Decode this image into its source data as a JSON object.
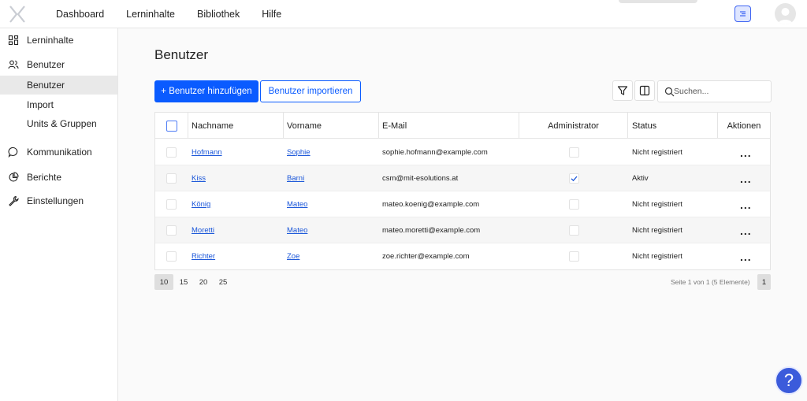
{
  "topnav": {
    "items": [
      "Dashboard",
      "Lerninhalte",
      "Bibliothek",
      "Hilfe"
    ]
  },
  "sidebar": {
    "items": [
      {
        "label": "Lerninhalte",
        "icon": "grid-icon"
      },
      {
        "label": "Benutzer",
        "icon": "users-icon"
      },
      {
        "label": "Benutzer",
        "sub": true,
        "active": true
      },
      {
        "label": "Import",
        "sub": true
      },
      {
        "label": "Units & Gruppen",
        "sub": true
      },
      {
        "label": "Kommunikation",
        "icon": "chat-icon"
      },
      {
        "label": "Berichte",
        "icon": "pie-chart-icon"
      },
      {
        "label": "Einstellungen",
        "icon": "wrench-icon"
      }
    ]
  },
  "page": {
    "title": "Benutzer",
    "add_button": "+ Benutzer hinzufügen",
    "import_button": "Benutzer importieren",
    "search_placeholder": "Suchen..."
  },
  "table": {
    "columns": [
      "Nachname",
      "Vorname",
      "E-Mail",
      "Administrator",
      "Status",
      "Aktionen"
    ],
    "rows": [
      {
        "lastname": "Hofmann",
        "firstname": "Sophie",
        "email": "sophie.hofmann@example.com",
        "admin": false,
        "status": "Nicht registriert",
        "actions": "..."
      },
      {
        "lastname": "Kiss",
        "firstname": "Barni",
        "email": "csm@mit-esolutions.at",
        "admin": true,
        "status": "Aktiv",
        "actions": "..."
      },
      {
        "lastname": "König",
        "firstname": "Mateo",
        "email": "mateo.koenig@example.com",
        "admin": false,
        "status": "Nicht registriert",
        "actions": "..."
      },
      {
        "lastname": "Moretti",
        "firstname": "Mateo",
        "email": "mateo.moretti@example.com",
        "admin": false,
        "status": "Nicht registriert",
        "actions": "..."
      },
      {
        "lastname": "Richter",
        "firstname": "Zoe",
        "email": "zoe.richter@example.com",
        "admin": false,
        "status": "Nicht registriert",
        "actions": "..."
      }
    ]
  },
  "pagination": {
    "sizes": [
      "10",
      "15",
      "20",
      "25"
    ],
    "selected": "10",
    "info": "Seite 1 von 1 (5 Elemente)",
    "current_page": "1"
  },
  "help": {
    "label": "?"
  },
  "colors": {
    "accent": "#0a5bff",
    "link": "#1a56d9",
    "help": "#3b5bdb"
  }
}
